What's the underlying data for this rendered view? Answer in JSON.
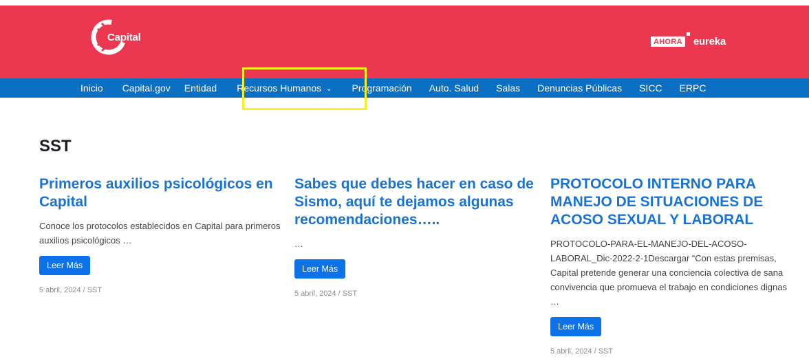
{
  "header": {
    "logo_text": "Capital",
    "ahora_label": "AHORA",
    "eureka_label": "eureka",
    "brand_color": "#ec3750"
  },
  "nav": {
    "background": "#0b6fc4",
    "items": [
      {
        "label": "Inicio"
      },
      {
        "label": "Capital.gov"
      },
      {
        "label": "Entidad"
      },
      {
        "label": "Recursos Humanos",
        "has_dropdown": true,
        "highlighted": true
      },
      {
        "label": "Programación"
      },
      {
        "label": "Auto. Salud"
      },
      {
        "label": "Salas"
      },
      {
        "label": "Denuncias Públicas"
      },
      {
        "label": "SICC"
      },
      {
        "label": "ERPC"
      }
    ]
  },
  "page": {
    "title": "SST"
  },
  "posts": [
    {
      "title": "Primeros auxilios psicológicos en Capital",
      "excerpt": "Conoce los protocolos establecidos en Capital para primeros auxilios psicológicos …",
      "button": "Leer Más",
      "meta": "5 abril, 2024 / SST"
    },
    {
      "title": "Sabes que debes hacer en caso de Sismo, aquí te dejamos algunas recomendaciones…..",
      "excerpt": "…",
      "button": "Leer Más",
      "meta": "5 abril, 2024 / SST"
    },
    {
      "title": "PROTOCOLO INTERNO PARA MANEJO DE SITUACIONES DE ACOSO SEXUAL Y LABORAL",
      "excerpt": "PROTOCOLO-PARA-EL-MANEJO-DEL-ACOSO-LABORAL_Dic-2022-2-1Descargar “Con estas premisas, Capital pretende generar una conciencia colectiva de sana convivencia que promueva el trabajo en condiciones dignas …",
      "button": "Leer Más",
      "meta": "5 abril, 2024 / SST"
    }
  ],
  "colors": {
    "accent_blue": "#0d72ea",
    "title_blue": "#1873d3",
    "highlight_yellow": "#f7f21c"
  }
}
